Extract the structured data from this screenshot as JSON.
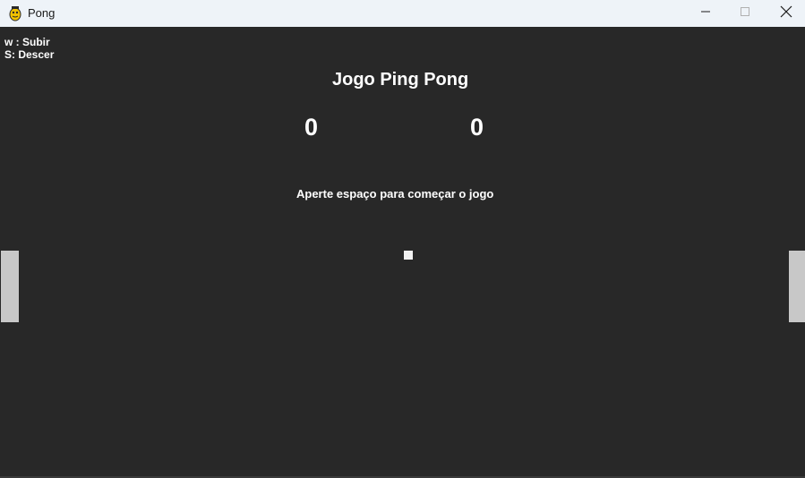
{
  "window": {
    "title": "Pong",
    "icon": "pygame-snake-icon",
    "controls": {
      "minimize_icon": "minimize-icon",
      "maximize_icon": "maximize-icon",
      "close_icon": "close-icon"
    }
  },
  "game": {
    "controls_help": [
      "w : Subir",
      "S: Descer"
    ],
    "title": "Jogo Ping Pong",
    "score_left": "0",
    "score_right": "0",
    "prompt": "Aperte espaço para começar o jogo"
  },
  "colors": {
    "background": "#282828",
    "paddle": "#c8c8c8",
    "ball": "#f2f2f2",
    "text": "#ffffff",
    "titlebar": "#eef3f8"
  }
}
